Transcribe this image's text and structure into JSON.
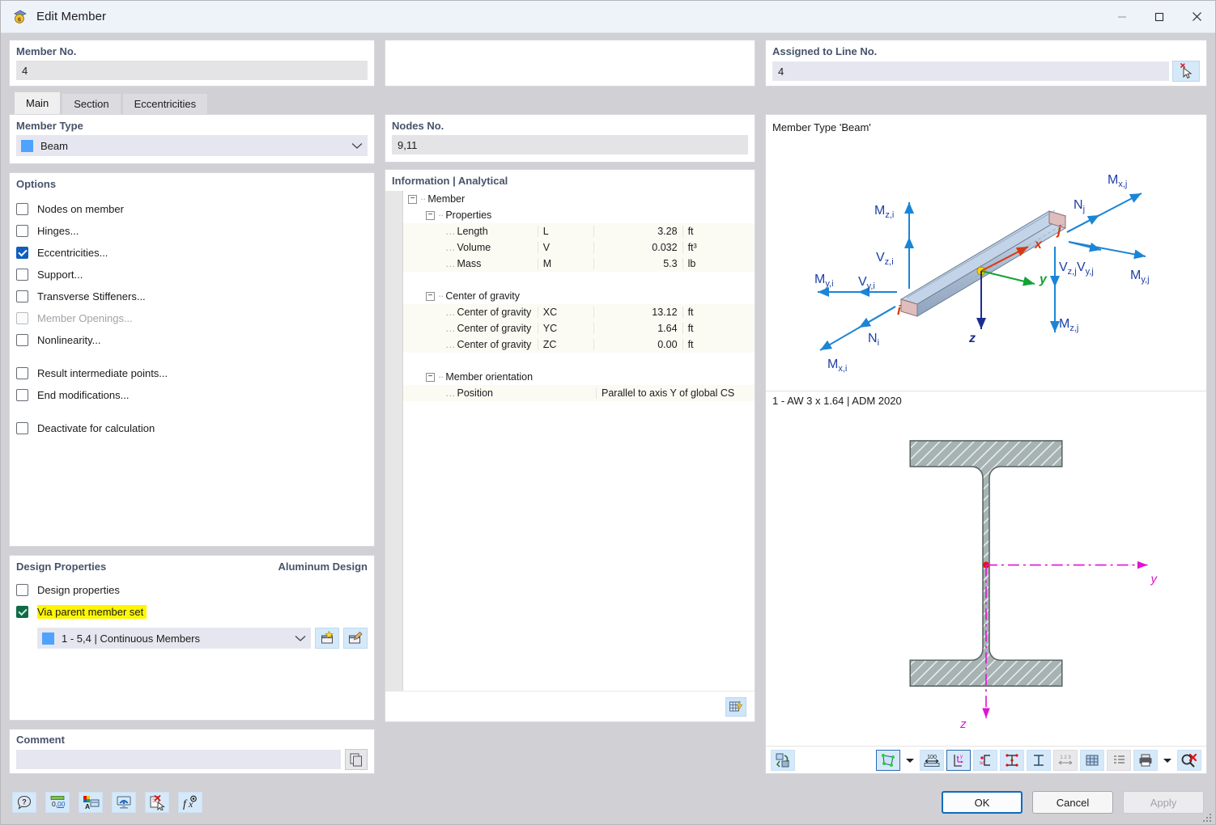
{
  "window": {
    "title": "Edit Member",
    "app_icon": "member-icon",
    "minimize": "minimize-icon",
    "maximize": "maximize-icon",
    "close": "close-icon"
  },
  "top": {
    "member_no_label": "Member No.",
    "member_no_value": "4",
    "line_no_label": "Assigned to Line No.",
    "line_no_value": "4",
    "line_pick_icon": "select-line-cursor-icon"
  },
  "tabs": [
    {
      "label": "Main",
      "active": true
    },
    {
      "label": "Section",
      "active": false
    },
    {
      "label": "Eccentricities",
      "active": false
    }
  ],
  "member_type": {
    "title": "Member Type",
    "value": "Beam",
    "swatch_color": "#4da3ff",
    "chevron": "chevron-down-icon"
  },
  "options": {
    "title": "Options",
    "items": [
      {
        "label": "Nodes on member",
        "checked": false,
        "disabled": false,
        "gap": false
      },
      {
        "label": "Hinges...",
        "checked": false,
        "disabled": false,
        "gap": false
      },
      {
        "label": "Eccentricities...",
        "checked": true,
        "disabled": false,
        "gap": false
      },
      {
        "label": "Support...",
        "checked": false,
        "disabled": false,
        "gap": false
      },
      {
        "label": "Transverse Stiffeners...",
        "checked": false,
        "disabled": false,
        "gap": false
      },
      {
        "label": "Member Openings...",
        "checked": false,
        "disabled": true,
        "gap": false
      },
      {
        "label": "Nonlinearity...",
        "checked": false,
        "disabled": false,
        "gap": false
      },
      {
        "label": "Result intermediate points...",
        "checked": false,
        "disabled": false,
        "gap": true
      },
      {
        "label": "End modifications...",
        "checked": false,
        "disabled": false,
        "gap": false
      },
      {
        "label": "Deactivate for calculation",
        "checked": false,
        "disabled": false,
        "gap": true
      }
    ]
  },
  "design_properties": {
    "title": "Design Properties",
    "right_title": "Aluminum Design",
    "design_properties_label": "Design properties",
    "design_properties_checked": false,
    "via_parent_label": "Via parent member set",
    "via_parent_checked": true,
    "via_parent_highlighted": true,
    "parent_set_value": "1 - 5,4 | Continuous Members",
    "parent_swatch_color": "#4da3ff",
    "new_button_icon": "new-member-set-icon",
    "edit_button_icon": "edit-member-set-icon"
  },
  "comment": {
    "title": "Comment",
    "value": "",
    "placeholder": "",
    "chevron": "chevron-down-icon",
    "copy_icon": "copy-comment-icon"
  },
  "nodes": {
    "title": "Nodes No.",
    "value": "9,11"
  },
  "information": {
    "title": "Information | Analytical",
    "tree": [
      {
        "level": 0,
        "label": "Member",
        "expander": "-",
        "band": false
      },
      {
        "level": 1,
        "label": "Properties",
        "expander": "-",
        "band": false
      },
      {
        "level": 2,
        "label": "Length",
        "symbol": "L",
        "value": "3.28",
        "unit": "ft",
        "band": true
      },
      {
        "level": 2,
        "label": "Volume",
        "symbol": "V",
        "value": "0.032",
        "unit": "ft³",
        "band": true
      },
      {
        "level": 2,
        "label": "Mass",
        "symbol": "M",
        "value": "5.3",
        "unit": "lb",
        "band": true
      },
      {
        "level": 0,
        "label": "",
        "spacer": true
      },
      {
        "level": 1,
        "label": "Center of gravity",
        "expander": "-",
        "band": false
      },
      {
        "level": 2,
        "label": "Center of gravity",
        "symbol": "XC",
        "value": "13.12",
        "unit": "ft",
        "band": true
      },
      {
        "level": 2,
        "label": "Center of gravity",
        "symbol": "YC",
        "value": "1.64",
        "unit": "ft",
        "band": true
      },
      {
        "level": 2,
        "label": "Center of gravity",
        "symbol": "ZC",
        "value": "0.00",
        "unit": "ft",
        "band": true
      },
      {
        "level": 0,
        "label": "",
        "spacer": true
      },
      {
        "level": 1,
        "label": "Member orientation",
        "expander": "-",
        "band": false
      },
      {
        "level": 2,
        "label": "Position",
        "symbol": "",
        "wide_value": "Parallel to axis Y of global CS",
        "band": true
      }
    ],
    "footer_icon": "table-export-icon"
  },
  "preview": {
    "member_type_caption": "Member Type 'Beam'",
    "section_caption": "1 - AW 3 x 1.64 | ADM 2020",
    "force_labels": {
      "mz_i": "M",
      "mz_i_sub": "z,i",
      "vz_i": "V",
      "vz_i_sub": "z,i",
      "my_i": "M",
      "my_i_sub": "y,i",
      "vy_i": "V",
      "vy_i_sub": "y,i",
      "n_i": "N",
      "n_i_sub": "i",
      "mx_i": "M",
      "mx_i_sub": "x,i",
      "mx_j": "M",
      "mx_j_sub": "x,j",
      "n_j": "N",
      "n_j_sub": "j",
      "vy_j": "V",
      "vy_j_sub": "y,j",
      "my_j": "M",
      "my_j_sub": "y,j",
      "vz_j": "V",
      "vz_j_sub": "z,j",
      "mz_j": "M",
      "mz_j_sub": "z,j"
    },
    "axes": {
      "x": "x",
      "y": "y",
      "z": "z",
      "node_i": "i",
      "node_j": "j"
    },
    "section_axes": {
      "y": "y",
      "z": "z"
    },
    "toolbar_icons": [
      "view-rotate-icon",
      "shape-select-icon",
      "shape-select-dropdown-icon",
      "dimensions-icon",
      "local-axes-icon",
      "shear-center-icon",
      "stress-points-icon",
      "section-outline-icon",
      "numbering-icon",
      "grid-icon",
      "list-icon",
      "print-icon",
      "print-dropdown-icon",
      "clear-icon"
    ]
  },
  "bottom": {
    "tools": [
      "help-icon",
      "decimal-places-icon",
      "display-properties-icon",
      "visibility-icon",
      "reset-icon",
      "formula-icon"
    ],
    "ok_label": "OK",
    "cancel_label": "Cancel",
    "apply_label": "Apply",
    "apply_disabled": true
  }
}
